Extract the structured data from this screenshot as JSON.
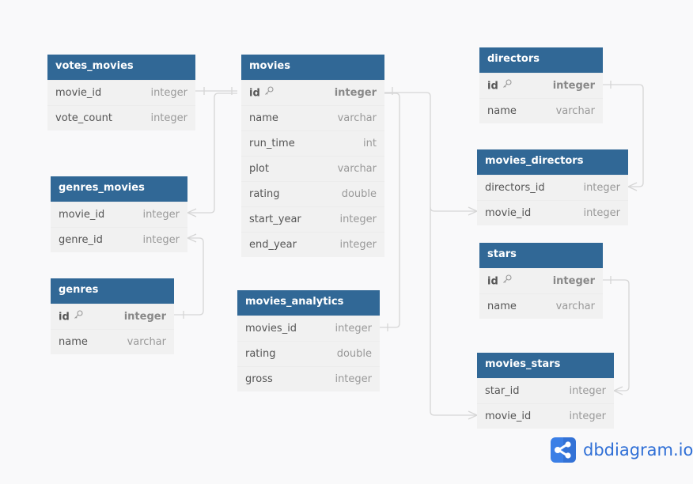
{
  "tables": {
    "votes_movies": {
      "name": "votes_movies",
      "fields": [
        {
          "name": "movie_id",
          "type": "integer"
        },
        {
          "name": "vote_count",
          "type": "integer"
        }
      ]
    },
    "movies": {
      "name": "movies",
      "fields": [
        {
          "name": "id",
          "type": "integer",
          "pk": true
        },
        {
          "name": "name",
          "type": "varchar"
        },
        {
          "name": "run_time",
          "type": "int"
        },
        {
          "name": "plot",
          "type": "varchar"
        },
        {
          "name": "rating",
          "type": "double"
        },
        {
          "name": "start_year",
          "type": "integer"
        },
        {
          "name": "end_year",
          "type": "integer"
        }
      ]
    },
    "directors": {
      "name": "directors",
      "fields": [
        {
          "name": "id",
          "type": "integer",
          "pk": true
        },
        {
          "name": "name",
          "type": "varchar"
        }
      ]
    },
    "movies_directors": {
      "name": "movies_directors",
      "fields": [
        {
          "name": "directors_id",
          "type": "integer"
        },
        {
          "name": "movie_id",
          "type": "integer"
        }
      ]
    },
    "genres_movies": {
      "name": "genres_movies",
      "fields": [
        {
          "name": "movie_id",
          "type": "integer"
        },
        {
          "name": "genre_id",
          "type": "integer"
        }
      ]
    },
    "genres": {
      "name": "genres",
      "fields": [
        {
          "name": "id",
          "type": "integer",
          "pk": true
        },
        {
          "name": "name",
          "type": "varchar"
        }
      ]
    },
    "movies_analytics": {
      "name": "movies_analytics",
      "fields": [
        {
          "name": "movies_id",
          "type": "integer"
        },
        {
          "name": "rating",
          "type": "double"
        },
        {
          "name": "gross",
          "type": "integer"
        }
      ]
    },
    "stars": {
      "name": "stars",
      "fields": [
        {
          "name": "id",
          "type": "integer",
          "pk": true
        },
        {
          "name": "name",
          "type": "varchar"
        }
      ]
    },
    "movies_stars": {
      "name": "movies_stars",
      "fields": [
        {
          "name": "star_id",
          "type": "integer"
        },
        {
          "name": "movie_id",
          "type": "integer"
        }
      ]
    }
  },
  "relationships": [
    {
      "from": "votes_movies.movie_id",
      "to": "movies.id",
      "type": "one-to-one"
    },
    {
      "from": "genres_movies.movie_id",
      "to": "movies.id",
      "type": "many-to-one"
    },
    {
      "from": "genres_movies.genre_id",
      "to": "genres.id",
      "type": "many-to-one"
    },
    {
      "from": "movies_analytics.movies_id",
      "to": "movies.id",
      "type": "one-to-one"
    },
    {
      "from": "movies_directors.movie_id",
      "to": "movies.id",
      "type": "many-to-one"
    },
    {
      "from": "movies_directors.directors_id",
      "to": "directors.id",
      "type": "many-to-one"
    },
    {
      "from": "movies_stars.movie_id",
      "to": "movies.id",
      "type": "many-to-one"
    },
    {
      "from": "movies_stars.star_id",
      "to": "stars.id",
      "type": "many-to-one"
    }
  ],
  "brand": {
    "label": "dbdiagram.io",
    "icon": "share-nodes-icon",
    "color": "#2f6fd6"
  },
  "colors": {
    "header": "#316896",
    "body": "#f1f1f1",
    "line": "#d4d4d4"
  }
}
